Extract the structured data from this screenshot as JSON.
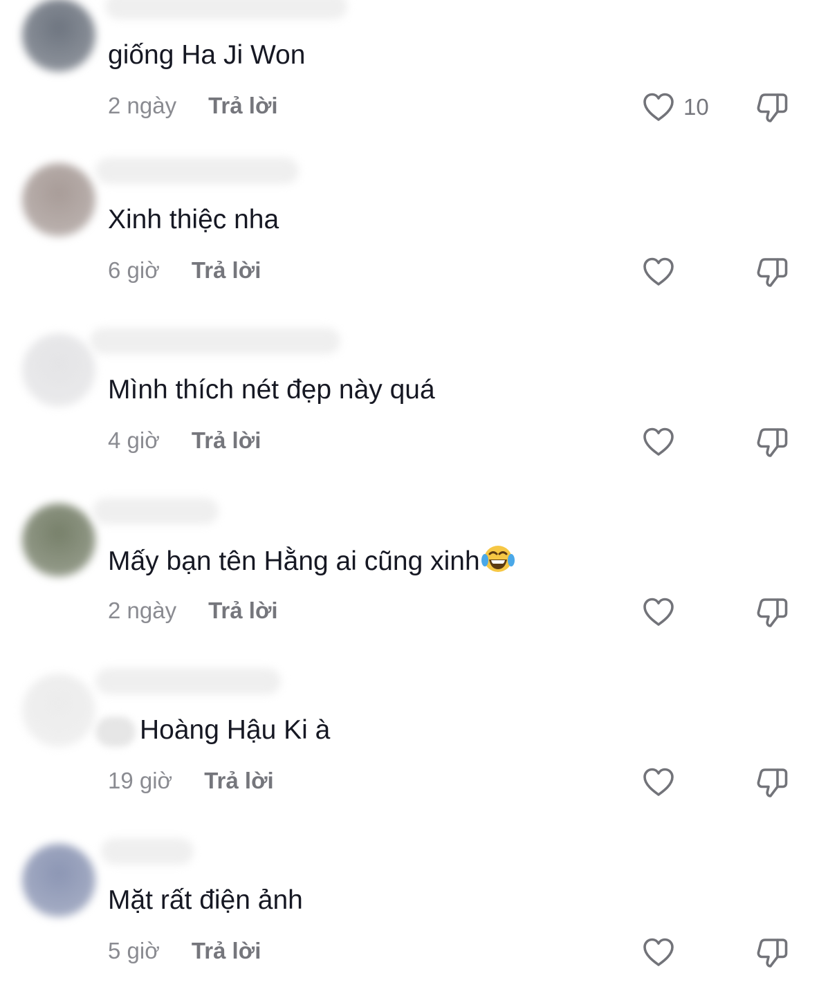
{
  "colors": {
    "text": "#161823",
    "meta": "#8a8b91",
    "icon": "#727379",
    "username_blur": "#efefef"
  },
  "comments": [
    {
      "text": "giống Ha Ji Won",
      "mention": false,
      "time": "2 ngày",
      "reply_label": "Trả lời",
      "like_count": "10",
      "emoji": null,
      "avatar_color": "#6e7580",
      "icons": [
        "heart-icon",
        "thumbs-down-icon"
      ]
    },
    {
      "text": "Xinh thiệc nha",
      "mention": false,
      "time": "6 giờ",
      "reply_label": "Trả lời",
      "like_count": "",
      "emoji": null,
      "avatar_color": "#a89c98",
      "icons": [
        "heart-icon",
        "thumbs-down-icon"
      ]
    },
    {
      "text": "Mình thích nét đẹp này quá",
      "mention": false,
      "time": "4 giờ",
      "reply_label": "Trả lời",
      "like_count": "",
      "emoji": null,
      "avatar_color": "#e4e4e6",
      "icons": [
        "heart-icon",
        "thumbs-down-icon"
      ]
    },
    {
      "text": "Mấy bạn tên Hằng ai cũng xinh",
      "mention": false,
      "time": "2 ngày",
      "reply_label": "Trả lời",
      "like_count": "",
      "emoji": "face-with-tears-of-joy",
      "avatar_color": "#77806a",
      "icons": [
        "heart-icon",
        "thumbs-down-icon"
      ]
    },
    {
      "text": "Hoàng Hậu Ki à",
      "mention": true,
      "time": "19 giờ",
      "reply_label": "Trả lời",
      "like_count": "",
      "emoji": null,
      "avatar_color": "#ececec",
      "icons": [
        "heart-icon",
        "thumbs-down-icon"
      ]
    },
    {
      "text": "Mặt rất điện ảnh",
      "mention": false,
      "time": "5 giờ",
      "reply_label": "Trả lời",
      "like_count": "",
      "emoji": null,
      "avatar_color": "#8c96b4",
      "icons": [
        "heart-icon",
        "thumbs-down-icon"
      ]
    }
  ]
}
